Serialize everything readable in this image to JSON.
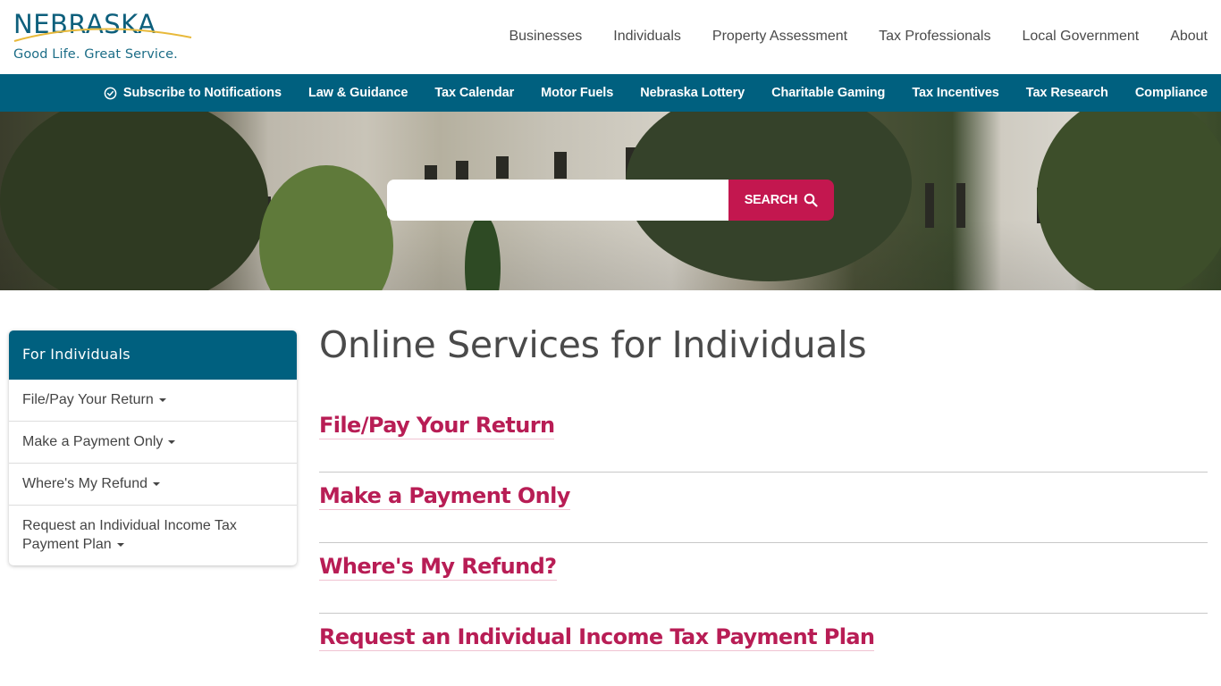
{
  "header": {
    "logo_word": "NEBRASKA",
    "logo_tagline": "Good Life. Great Service.",
    "main_nav": [
      {
        "label": "Businesses"
      },
      {
        "label": "Individuals"
      },
      {
        "label": "Property Assessment"
      },
      {
        "label": "Tax Professionals"
      },
      {
        "label": "Local Government"
      },
      {
        "label": "About"
      }
    ]
  },
  "sub_nav": {
    "subscribe": {
      "label": "Subscribe to Notifications",
      "icon": "check-circle-icon"
    },
    "items": [
      {
        "label": "Law & Guidance"
      },
      {
        "label": "Tax Calendar"
      },
      {
        "label": "Motor Fuels"
      },
      {
        "label": "Nebraska Lottery"
      },
      {
        "label": "Charitable Gaming"
      },
      {
        "label": "Tax Incentives"
      },
      {
        "label": "Tax Research"
      },
      {
        "label": "Compliance"
      }
    ]
  },
  "search": {
    "value": "",
    "placeholder": "",
    "button_label": "SEARCH",
    "button_icon": "search-icon"
  },
  "sidebar": {
    "title": "For Individuals",
    "items": [
      {
        "label": "File/Pay Your Return"
      },
      {
        "label": "Make a Payment Only"
      },
      {
        "label": "Where's My Refund"
      },
      {
        "label": "Request an Individual Income Tax Payment Plan"
      }
    ]
  },
  "main": {
    "title": "Online Services for Individuals",
    "services": [
      {
        "label": "File/Pay Your Return"
      },
      {
        "label": "Make a Payment Only"
      },
      {
        "label": "Where's My Refund?"
      },
      {
        "label": "Request an Individual Income Tax Payment Plan"
      }
    ]
  },
  "colors": {
    "brand_teal": "#00607f",
    "accent_crimson": "#c3174f",
    "link_crimson": "#b81d55",
    "logo_gold": "#e8b93a"
  }
}
